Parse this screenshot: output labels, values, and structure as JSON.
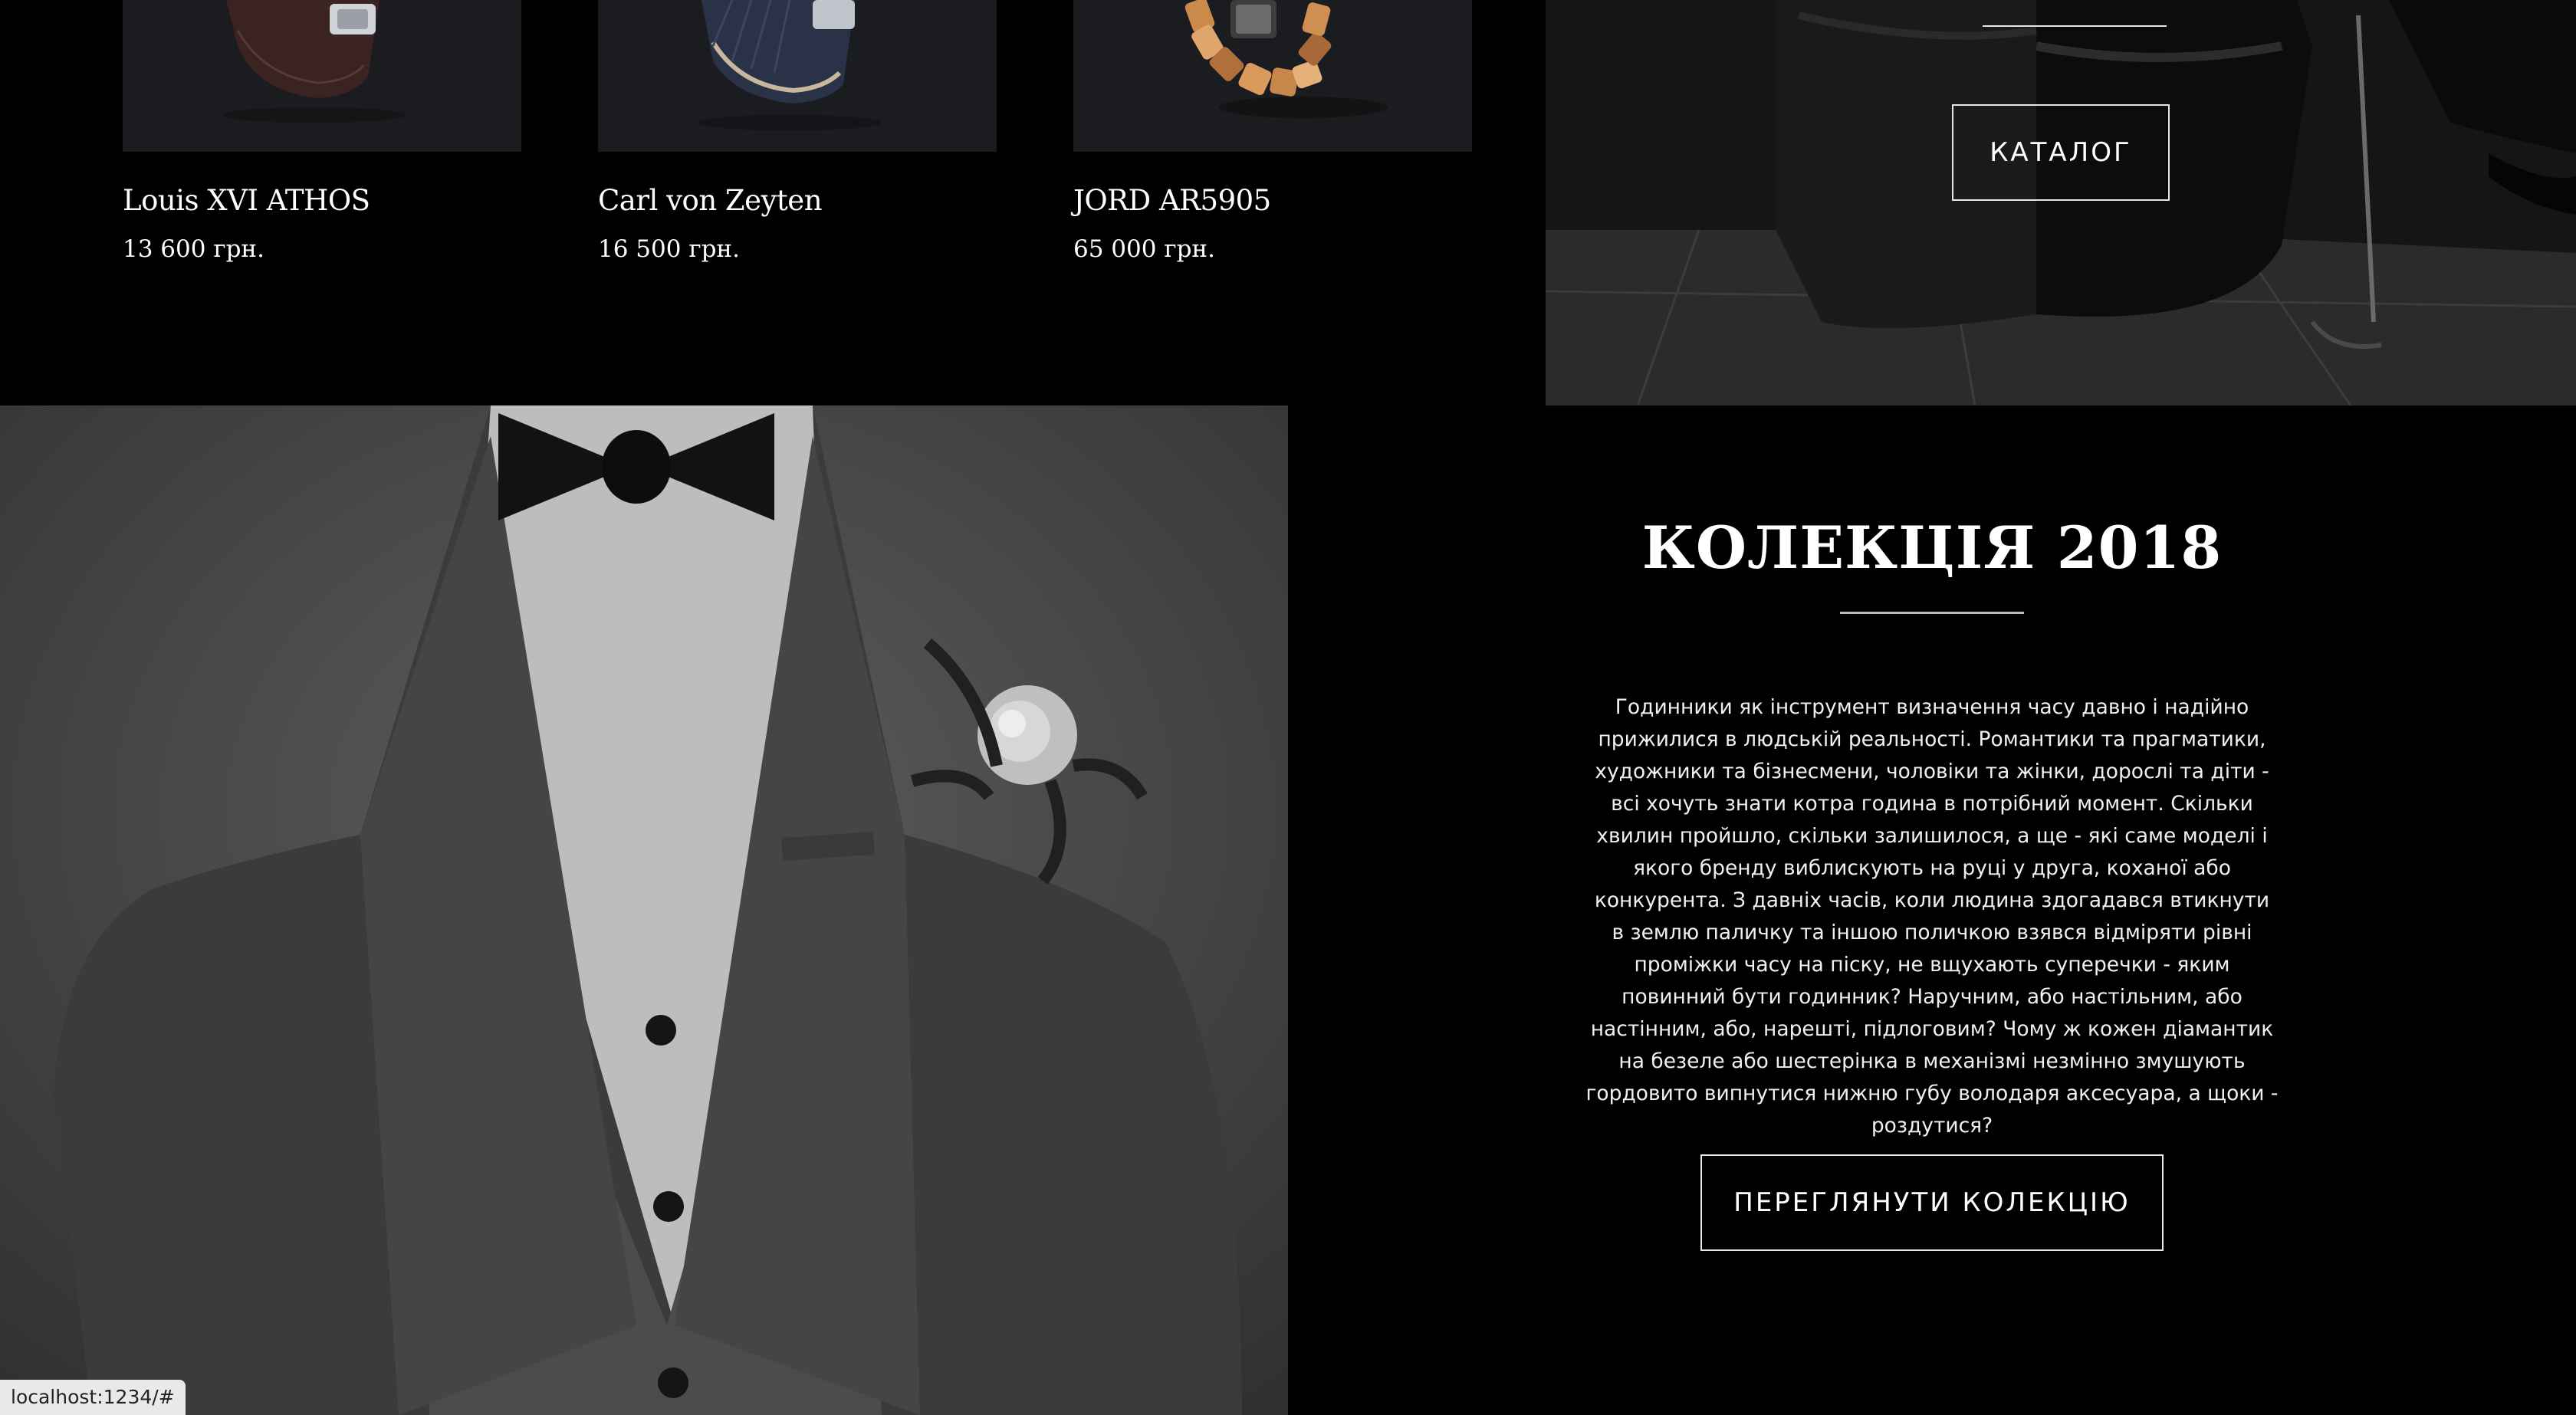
{
  "products": [
    {
      "name": "Louis XVI ATHOS",
      "price": "13 600 грн.",
      "image_icon": "watch-brown-leather-icon"
    },
    {
      "name": "Carl von Zeyten",
      "price": "16 500 грн.",
      "image_icon": "watch-blue-leather-icon"
    },
    {
      "name": "JORD AR5905",
      "price": "65 000 грн.",
      "image_icon": "watch-wood-bracelet-icon"
    }
  ],
  "catalog": {
    "button_label": "КАТАЛОГ"
  },
  "collection": {
    "title": "КОЛЕКЦІЯ 2018",
    "text": "Годинники як інструмент визначення часу давно і надійно прижилися в людській реальності. Романтики та прагматики, художники та бізнесмени, чоловіки та жінки, дорослі та діти - всі хочуть знати котра година в потрібний момент. Скільки хвилин пройшло, скільки залишилося, а ще - які саме моделі і якого бренду виблискують на руці у друга, коханої або конкурента. З давніх часів, коли людина здогадався втикнути в землю паличку та іншою поличкою взявся відміряти рівні проміжки часу на піску, не вщухають суперечки - яким повинний бути годинник? Наручним, або настільним, або настінним, або, нарешті, підлоговим? Чому ж кожен діамантик на безеле або шестерінка в механізмі незмінно змушують гордовито випнутися нижню губу володаря аксесуара, а щоки - роздутися?",
    "button_label": "ПЕРЕГЛЯНУТИ КОЛЕКЦІЮ"
  },
  "status_bar": {
    "url": "localhost:1234/#"
  },
  "colors": {
    "background": "#000000",
    "card_bg": "#1b1c1f",
    "border": "#e6e6e6",
    "text": "#ffffff"
  }
}
